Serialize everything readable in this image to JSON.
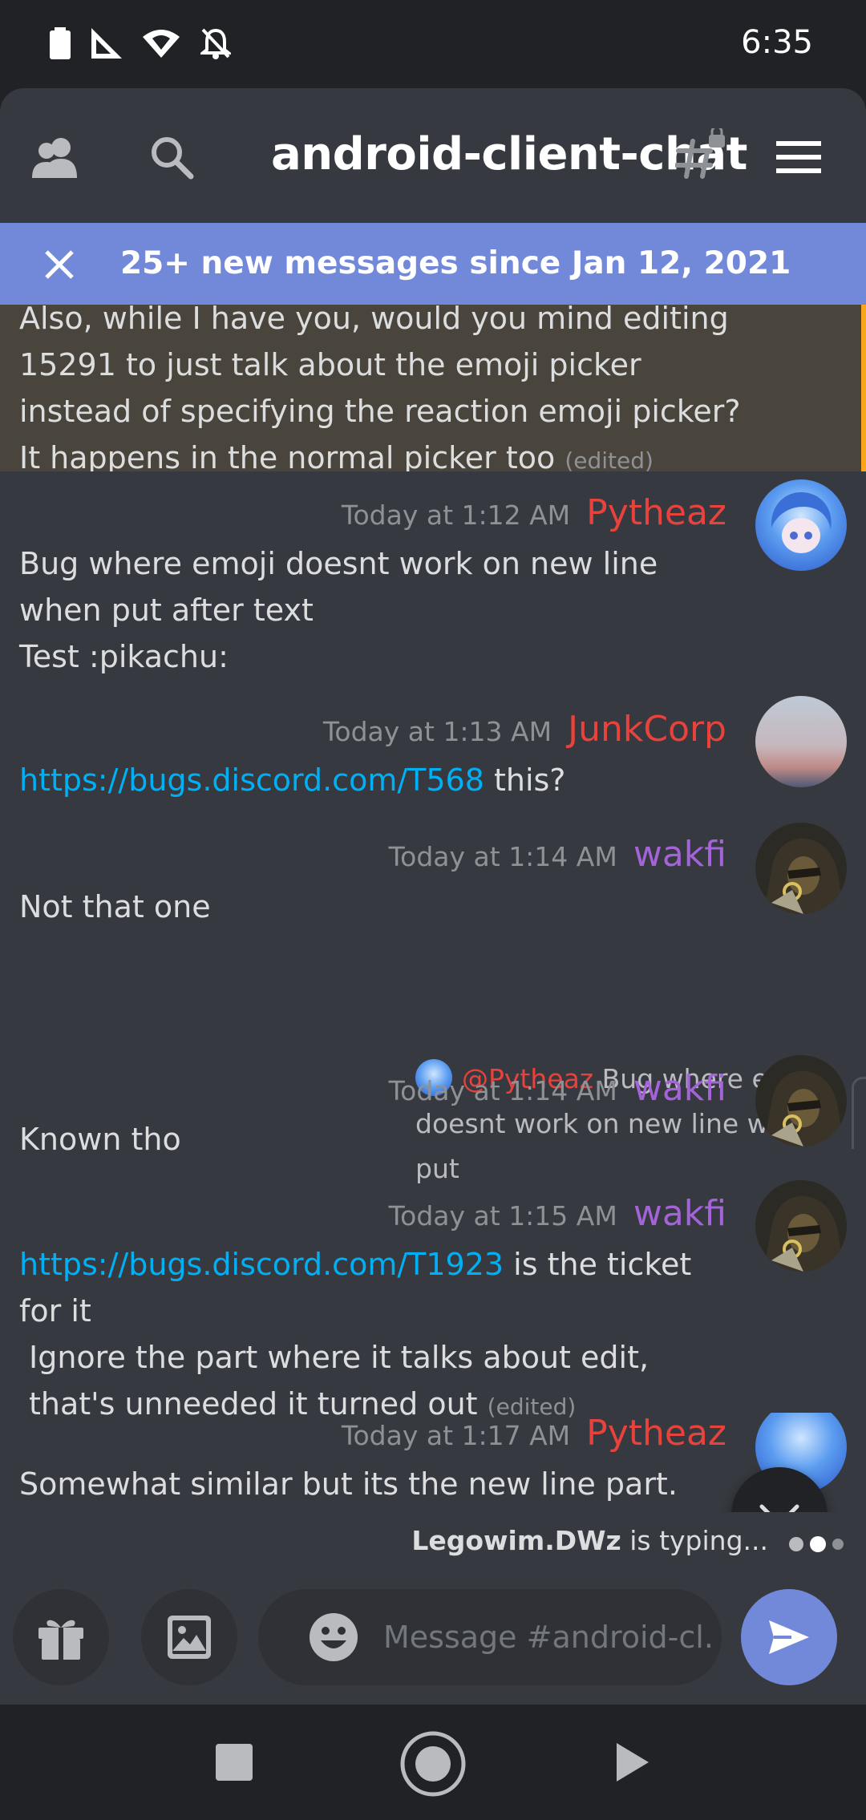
{
  "status_bar": {
    "time": "6:35",
    "icons": [
      "battery-icon",
      "signal-icon",
      "wifi-icon",
      "notifications-off-icon"
    ]
  },
  "header": {
    "channel_name": "android-client-chat",
    "icons": [
      "members-icon",
      "search-icon",
      "locked-channel-icon",
      "menu-icon"
    ]
  },
  "banner": {
    "text": "25+ new messages since Jan 12, 2021"
  },
  "highlighted_message": {
    "text": "Also, while I have you, would you mind editing 15291 to just talk about the emoji picker instead of specifying the reaction emoji picker? It happens in the normal picker too",
    "edited": "(edited)",
    "accent_color": "#faa61a"
  },
  "messages": [
    {
      "timestamp": "Today at 1:12 AM",
      "author": "Pytheaz",
      "author_color": "#e8423c",
      "lines": [
        "Bug where emoji doesnt work on new line when put after text",
        "Test :pikachu:"
      ]
    },
    {
      "timestamp": "Today at 1:13 AM",
      "author": "JunkCorp",
      "author_color": "#e8423c",
      "link": "https://bugs.discord.com/T568",
      "text_after_link": " this?"
    },
    {
      "timestamp": "Today at 1:14 AM",
      "author": "wakfi",
      "author_color": "#a463d8",
      "text": "Not that one"
    },
    {
      "reply": {
        "mention": "@Pytheaz",
        "text": "Bug where emoji doesnt work on new line when put"
      },
      "timestamp": "Today at 1:14 AM",
      "author": "wakfi",
      "author_color": "#a463d8",
      "text": "Known tho"
    },
    {
      "timestamp": "Today at 1:15 AM",
      "author": "wakfi",
      "author_color": "#a463d8",
      "link": "https://bugs.discord.com/T1923",
      "text_after_link": " is the ticket for it",
      "continuation": "Ignore the part where it talks about edit, that's unneeded it turned out",
      "edited": "(edited)"
    },
    {
      "timestamp": "Today at 1:17 AM",
      "author": "Pytheaz",
      "author_color": "#e8423c",
      "text": "Somewhat similar but its the new line part. Notice"
    }
  ],
  "typing": {
    "user": "Legowim.DWz",
    "suffix": " is typing..."
  },
  "composer": {
    "placeholder": "Message #android-cl..."
  },
  "colors": {
    "background": "#36393f",
    "banner": "#7289da",
    "link": "#00b0f4"
  }
}
